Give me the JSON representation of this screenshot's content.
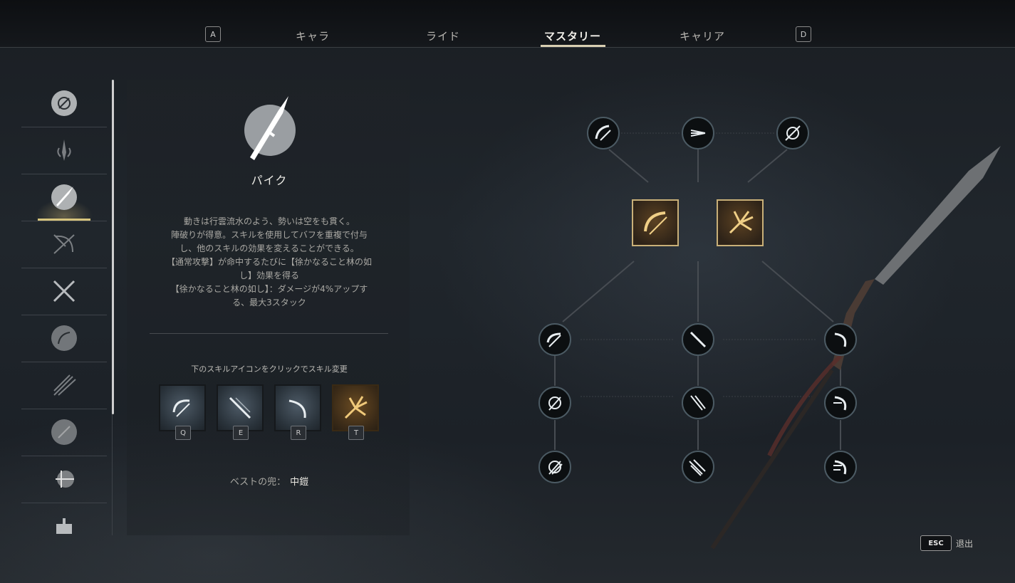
{
  "header": {
    "prev_key": "A",
    "next_key": "D",
    "tabs": [
      {
        "label": "キャラ"
      },
      {
        "label": "ライド"
      },
      {
        "label": "マスタリー"
      },
      {
        "label": "キャリア"
      }
    ],
    "active_tab": "マスタリー"
  },
  "weapon_list": [
    {
      "icon": "shield-icon"
    },
    {
      "icon": "flame-blade-icon"
    },
    {
      "icon": "pike-icon",
      "active": true
    },
    {
      "icon": "bow-icon"
    },
    {
      "icon": "dual-swords-icon"
    },
    {
      "icon": "fan-icon"
    },
    {
      "icon": "spears-icon"
    },
    {
      "icon": "sword-icon"
    },
    {
      "icon": "dart-icon"
    },
    {
      "icon": "lantern-icon"
    }
  ],
  "weapon": {
    "name": "パイク",
    "description": [
      "動きは行雲流水のよう、勢いは空をも貫く。",
      "陣破りが得意。スキルを使用してバフを重複で付与",
      "し、他のスキルの効果を変えることができる。",
      "【通常攻撃】が命中するたびに【徐かなること林の如",
      "し】効果を得る",
      "【徐かなること林の如し】：ダメージが4%アップす",
      "る、最大3スタック"
    ],
    "skill_hint": "下のスキルアイコンをクリックでスキル変更",
    "skills": [
      {
        "key": "Q",
        "icon": "spin-slash-icon"
      },
      {
        "key": "E",
        "icon": "thrust-icon"
      },
      {
        "key": "R",
        "icon": "crescent-icon"
      },
      {
        "key": "T",
        "icon": "burst-icon"
      }
    ],
    "best_armor_label": "ベストの兜：",
    "best_armor_value": "中鎧"
  },
  "tree": {
    "top_nodes": [
      "slash-icon",
      "triple-thrust-icon",
      "whirl-icon"
    ],
    "gold_nodes": [
      "gold-slash-icon",
      "gold-burst-icon"
    ],
    "columns": [
      [
        "spin-slash-icon",
        "spin-slash-2-icon",
        "spin-slash-3-icon"
      ],
      [
        "thrust-icon",
        "double-thrust-icon",
        "triple-thrust-2-icon"
      ],
      [
        "crescent-icon",
        "crescent-2-icon",
        "crescent-3-icon"
      ]
    ]
  },
  "footer": {
    "esc_key": "ESC",
    "exit_label": "退出"
  },
  "colors": {
    "accent_gold": "#c9b078",
    "active_bar": "#d7c57d",
    "node_border": "#4b5a63"
  }
}
